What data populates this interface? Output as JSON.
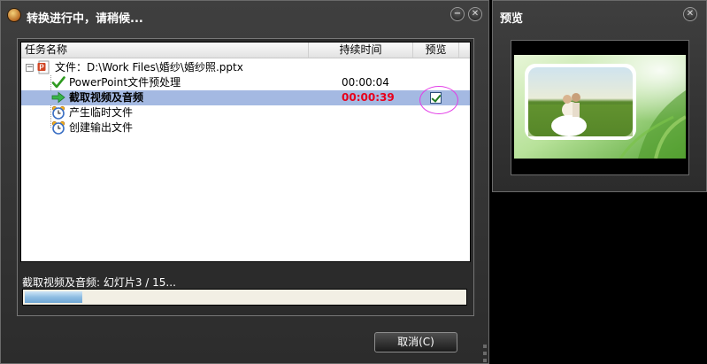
{
  "main_window": {
    "title": "转换进行中，请稍候...",
    "minimize_glyph": "−",
    "close_glyph": "✕",
    "columns": {
      "task_name": "任务名称",
      "duration": "持续时间",
      "preview": "预览"
    },
    "tree": {
      "expander_glyph": "−",
      "root": {
        "label": "文件：D:\\Work Files\\婚纱\\婚纱照.pptx",
        "icon": "powerpoint-file-icon"
      },
      "steps": [
        {
          "label": "PowerPoint文件预处理",
          "duration": "00:00:04",
          "icon": "checkmark-icon",
          "state": "done"
        },
        {
          "label": "截取视频及音频",
          "duration": "00:00:39",
          "icon": "green-arrow-icon",
          "state": "in-progress",
          "preview_checked": true
        },
        {
          "label": "产生临时文件",
          "duration": "",
          "icon": "alarm-clock-icon",
          "state": "pending"
        },
        {
          "label": "创建输出文件",
          "duration": "",
          "icon": "alarm-clock-icon",
          "state": "pending"
        }
      ]
    },
    "status_text": "截取视频及音频: 幻灯片3 / 15...",
    "progress_fraction": 0.13,
    "cancel_label": "取消(C)"
  },
  "preview_window": {
    "title": "预览",
    "close_glyph": "✕",
    "image": "wedding-photo-thumbnail"
  },
  "colors": {
    "window_bg": "#333333",
    "selected_row": "#a4b9e2",
    "in_progress_time": "#e8001c",
    "progress_fill": "#8fbde2",
    "annotation_circle": "#e23be6"
  }
}
